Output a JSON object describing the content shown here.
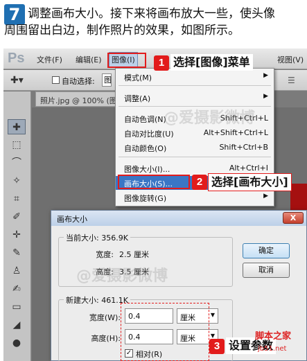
{
  "header": {
    "step_number": "7",
    "line1": "调整画布大小。接下来将画布放大一些，使头像",
    "line2": "周围留出白边，制作照片的效果，如图所示。"
  },
  "app": {
    "logo": "Ps",
    "menus": [
      "文件(F)",
      "编辑(E)",
      "图像(I)",
      "视图(V)"
    ],
    "active_menu": "图像(I)"
  },
  "options_bar": {
    "auto_select_label": "自动选择:",
    "select_value": "图"
  },
  "document_tab": "照片.jpg @ 100% (图",
  "image_menu": {
    "items": [
      {
        "label": "模式(M)",
        "shortcut": "",
        "submenu": true
      },
      {
        "label": "调整(A)",
        "shortcut": "",
        "submenu": true
      },
      {
        "label": "自动色调(N)",
        "shortcut": "Shift+Ctrl+L",
        "submenu": false
      },
      {
        "label": "自动对比度(U)",
        "shortcut": "Alt+Shift+Ctrl+L",
        "submenu": false
      },
      {
        "label": "自动颜色(O)",
        "shortcut": "Shift+Ctrl+B",
        "submenu": false
      },
      {
        "label": "图像大小(I)...",
        "shortcut": "Alt+Ctrl+I",
        "submenu": false
      },
      {
        "label": "画布大小(S)...",
        "shortcut": "",
        "submenu": false
      },
      {
        "label": "图像旋转(G)",
        "shortcut": "",
        "submenu": true
      }
    ],
    "highlighted": "画布大小(S)..."
  },
  "callouts": [
    {
      "num": "1",
      "text": "选择[图像]菜单"
    },
    {
      "num": "2",
      "text": "选择[画布大小]"
    },
    {
      "num": "3",
      "text": "设置参数"
    }
  ],
  "dialog": {
    "title": "画布大小",
    "close": "X",
    "current_size": {
      "title": "当前大小: 356.9K",
      "width_label": "宽度:",
      "width_value": "2.5 厘米",
      "height_label": "高度:",
      "height_value": "3.5 厘米"
    },
    "new_size": {
      "title": "新建大小: 461.1K",
      "width_label": "宽度(W):",
      "width_value": "0.4",
      "width_unit": "厘米",
      "height_label": "高度(H):",
      "height_value": "0.4",
      "height_unit": "厘米",
      "relative_label": "相对(R)",
      "relative_checked": true
    },
    "ok": "确定",
    "cancel": "取消"
  },
  "watermarks": [
    "@爱摄影微博",
    "@爱摄影微博"
  ],
  "site": {
    "name": "脚本之家",
    "url": "jb51.net"
  }
}
